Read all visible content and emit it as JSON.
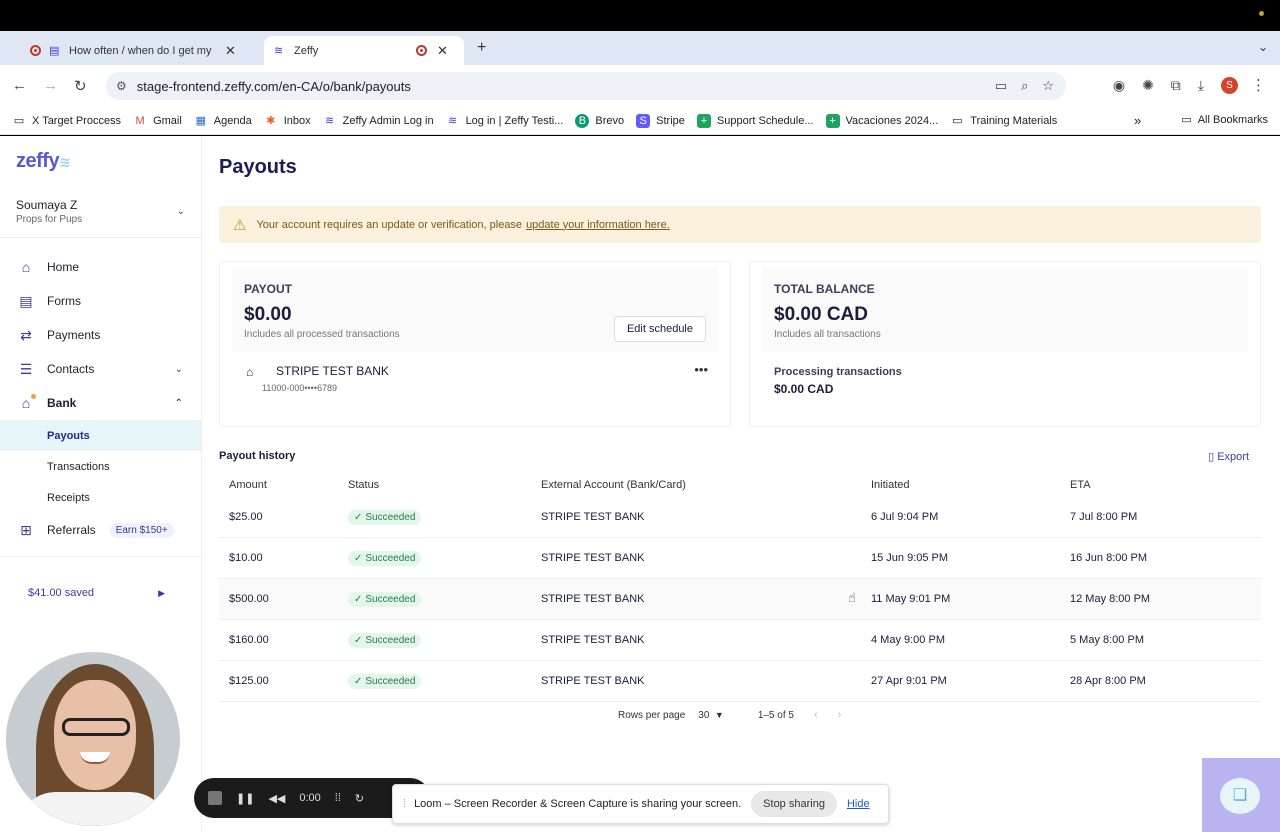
{
  "browser": {
    "tabs": [
      {
        "title": "How often / when do I get my",
        "active": false
      },
      {
        "title": "Zeffy",
        "active": true
      }
    ],
    "url": "stage-frontend.zeffy.com/en-CA/o/bank/payouts",
    "profile_initial": "S",
    "bookmarks": [
      {
        "label": "X Target Proccess",
        "icon": "folder-icon"
      },
      {
        "label": "Gmail",
        "icon": "gmail-icon"
      },
      {
        "label": "Agenda",
        "icon": "calendar-icon"
      },
      {
        "label": "Inbox",
        "icon": "hubspot-icon"
      },
      {
        "label": "Zeffy Admin Log in",
        "icon": "zeffy-icon"
      },
      {
        "label": "Log in | Zeffy Testi...",
        "icon": "zeffy-icon"
      },
      {
        "label": "Brevo",
        "icon": "brevo-icon"
      },
      {
        "label": "Stripe",
        "icon": "stripe-icon"
      },
      {
        "label": "Support Schedule...",
        "icon": "sheets-icon"
      },
      {
        "label": "Vacaciones 2024...",
        "icon": "sheets-icon"
      },
      {
        "label": "Training Materials",
        "icon": "folder-icon"
      }
    ],
    "all_bookmarks": "All Bookmarks"
  },
  "sidebar": {
    "logo": "zeffy",
    "user_name": "Soumaya Z",
    "org_name": "Props for Pups",
    "nav": {
      "home": "Home",
      "forms": "Forms",
      "payments": "Payments",
      "contacts": "Contacts",
      "bank": "Bank",
      "payouts": "Payouts",
      "transactions": "Transactions",
      "receipts": "Receipts",
      "referrals": "Referrals",
      "earn_badge": "Earn $150+"
    },
    "saved": "$41.00 saved"
  },
  "main": {
    "title": "Payouts",
    "alert_text": "Your account requires an update or verification, please",
    "alert_link": "update your information here.",
    "payout_card": {
      "label": "PAYOUT",
      "amount": "$0.00",
      "hint": "Includes all processed transactions",
      "edit_button": "Edit schedule",
      "bank_name": "STRIPE TEST BANK",
      "bank_account": "11000-000••••6789"
    },
    "balance_card": {
      "label": "TOTAL BALANCE",
      "amount": "$0.00 CAD",
      "hint": "Includes all transactions",
      "processing_label": "Processing transactions",
      "processing_value": "$0.00 CAD"
    },
    "history_title": "Payout history",
    "export_label": "Export",
    "table": {
      "headers": [
        "Amount",
        "Status",
        "External Account (Bank/Card)",
        "Initiated",
        "ETA"
      ],
      "rows": [
        {
          "amount": "$25.00",
          "status": "Succeeded",
          "account": "STRIPE TEST BANK",
          "initiated": "6 Jul 9:04 PM",
          "eta": "7 Jul 8:00 PM"
        },
        {
          "amount": "$10.00",
          "status": "Succeeded",
          "account": "STRIPE TEST BANK",
          "initiated": "15 Jun 9:05 PM",
          "eta": "16 Jun 8:00 PM"
        },
        {
          "amount": "$500.00",
          "status": "Succeeded",
          "account": "STRIPE TEST BANK",
          "initiated": "11 May 9:01 PM",
          "eta": "12 May 8:00 PM"
        },
        {
          "amount": "$160.00",
          "status": "Succeeded",
          "account": "STRIPE TEST BANK",
          "initiated": "4 May 9:00 PM",
          "eta": "5 May 8:00 PM"
        },
        {
          "amount": "$125.00",
          "status": "Succeeded",
          "account": "STRIPE TEST BANK",
          "initiated": "27 Apr 9:01 PM",
          "eta": "28 Apr 8:00 PM"
        }
      ]
    },
    "pagination": {
      "rows_per_page_label": "Rows per page",
      "rows_per_page": "30",
      "range": "1–5 of 5"
    }
  },
  "overlays": {
    "recorder_time": "0:00",
    "share_text": "Loom – Screen Recorder & Screen Capture is sharing your screen.",
    "stop_sharing": "Stop sharing",
    "hide": "Hide"
  },
  "colors": {
    "brand": "#5b57d6",
    "alert_bg": "#fbf0dc",
    "success_bg": "#e2f6ea",
    "active_nav_bg": "#e6f6f8"
  }
}
